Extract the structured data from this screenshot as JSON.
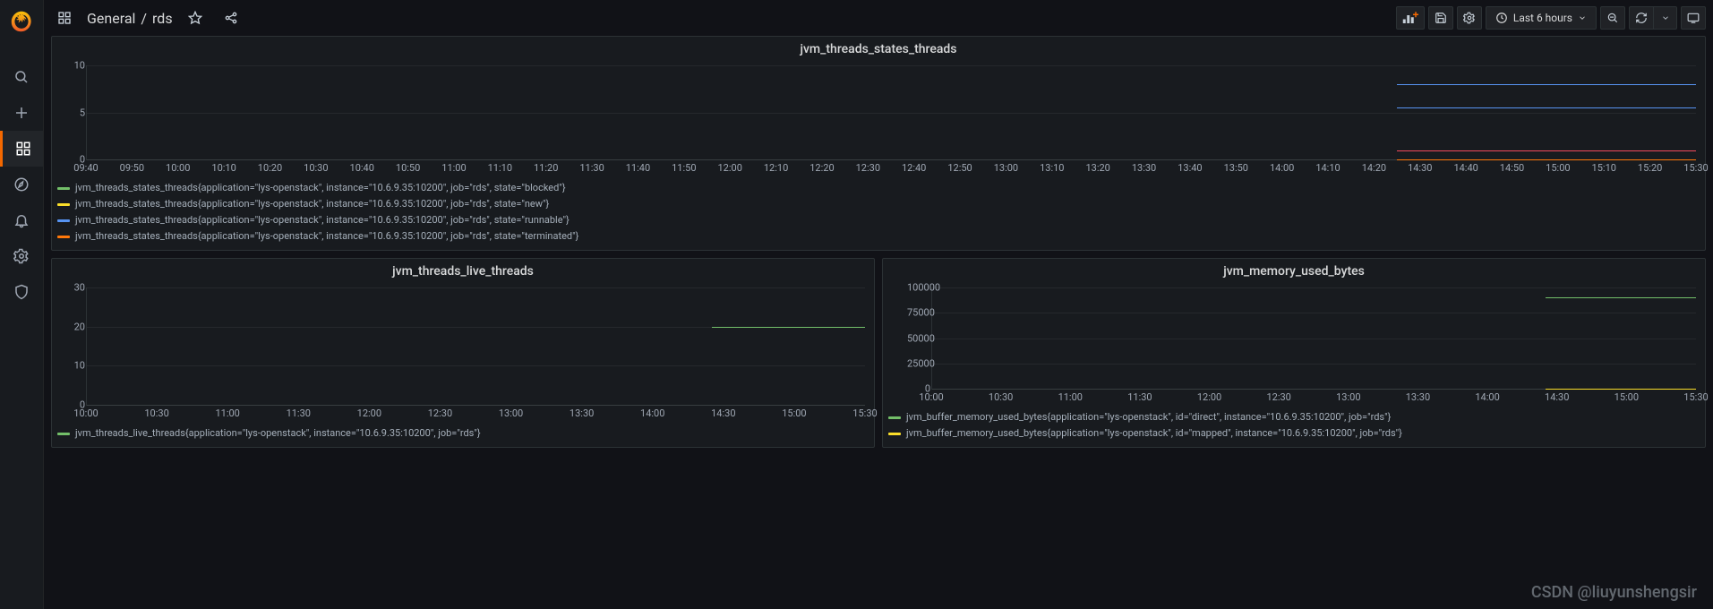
{
  "breadcrumb": {
    "folder": "General",
    "sep": "/",
    "name": "rds"
  },
  "toolbar": {
    "timerange": "Last 6 hours"
  },
  "sidebar": {
    "items": [
      "logo",
      "search",
      "create",
      "dashboards",
      "explore",
      "alerting",
      "config",
      "admin"
    ]
  },
  "panels": [
    {
      "title": "jvm_threads_states_threads"
    },
    {
      "title": "jvm_threads_live_threads"
    },
    {
      "title": "jvm_memory_used_bytes"
    }
  ],
  "chart_data": [
    {
      "type": "line",
      "title": "jvm_threads_states_threads",
      "xlabel": "",
      "ylabel": "",
      "ylim": [
        0,
        10
      ],
      "y_ticks": [
        0,
        5,
        10
      ],
      "x_ticks": [
        "09:40",
        "09:50",
        "10:00",
        "10:10",
        "10:20",
        "10:30",
        "10:40",
        "10:50",
        "11:00",
        "11:10",
        "11:20",
        "11:30",
        "11:40",
        "11:50",
        "12:00",
        "12:10",
        "12:20",
        "12:30",
        "12:40",
        "12:50",
        "13:00",
        "13:10",
        "13:20",
        "13:30",
        "13:40",
        "13:50",
        "14:00",
        "14:10",
        "14:20",
        "14:30",
        "14:40",
        "14:50",
        "15:00",
        "15:10",
        "15:20",
        "15:30"
      ],
      "data_start": "14:25",
      "series": [
        {
          "name": "jvm_threads_states_threads{application=\"lys-openstack\", instance=\"10.6.9.35:10200\", job=\"rds\", state=\"blocked\"}",
          "color": "#73bf69",
          "value": 0
        },
        {
          "name": "jvm_threads_states_threads{application=\"lys-openstack\", instance=\"10.6.9.35:10200\", job=\"rds\", state=\"new\"}",
          "color": "#fade2a",
          "value": 0
        },
        {
          "name": "jvm_threads_states_threads{application=\"lys-openstack\", instance=\"10.6.9.35:10200\", job=\"rds\", state=\"runnable\"}",
          "color": "#5794f2",
          "value": 8
        },
        {
          "name": "jvm_threads_states_threads{application=\"lys-openstack\", instance=\"10.6.9.35:10200\", job=\"rds\", state=\"terminated\"}",
          "color": "#ff780a",
          "value": 0
        }
      ],
      "extra_lines": [
        {
          "color": "#5794f2",
          "value": 5.5
        },
        {
          "color": "#f2495c",
          "value": 1
        }
      ]
    },
    {
      "type": "line",
      "title": "jvm_threads_live_threads",
      "ylim": [
        0,
        30
      ],
      "y_ticks": [
        0,
        10,
        20,
        30
      ],
      "x_ticks": [
        "10:00",
        "10:30",
        "11:00",
        "11:30",
        "12:00",
        "12:30",
        "13:00",
        "13:30",
        "14:00",
        "14:30",
        "15:00",
        "15:30"
      ],
      "data_start": "14:25",
      "series": [
        {
          "name": "jvm_threads_live_threads{application=\"lys-openstack\", instance=\"10.6.9.35:10200\", job=\"rds\"}",
          "color": "#73bf69",
          "value": 20
        }
      ]
    },
    {
      "type": "line",
      "title": "jvm_memory_used_bytes",
      "ylim": [
        0,
        100000
      ],
      "y_ticks": [
        0,
        25000,
        50000,
        75000,
        100000
      ],
      "x_ticks": [
        "10:00",
        "10:30",
        "11:00",
        "11:30",
        "12:00",
        "12:30",
        "13:00",
        "13:30",
        "14:00",
        "14:30",
        "15:00",
        "15:30"
      ],
      "data_start": "14:25",
      "series": [
        {
          "name": "jvm_buffer_memory_used_bytes{application=\"lys-openstack\", id=\"direct\", instance=\"10.6.9.35:10200\", job=\"rds\"}",
          "color": "#73bf69",
          "value": 90000
        },
        {
          "name": "jvm_buffer_memory_used_bytes{application=\"lys-openstack\", id=\"mapped\", instance=\"10.6.9.35:10200\", job=\"rds\"}",
          "color": "#fade2a",
          "value": 0
        }
      ]
    }
  ],
  "watermark": "CSDN @liuyunshengsir"
}
